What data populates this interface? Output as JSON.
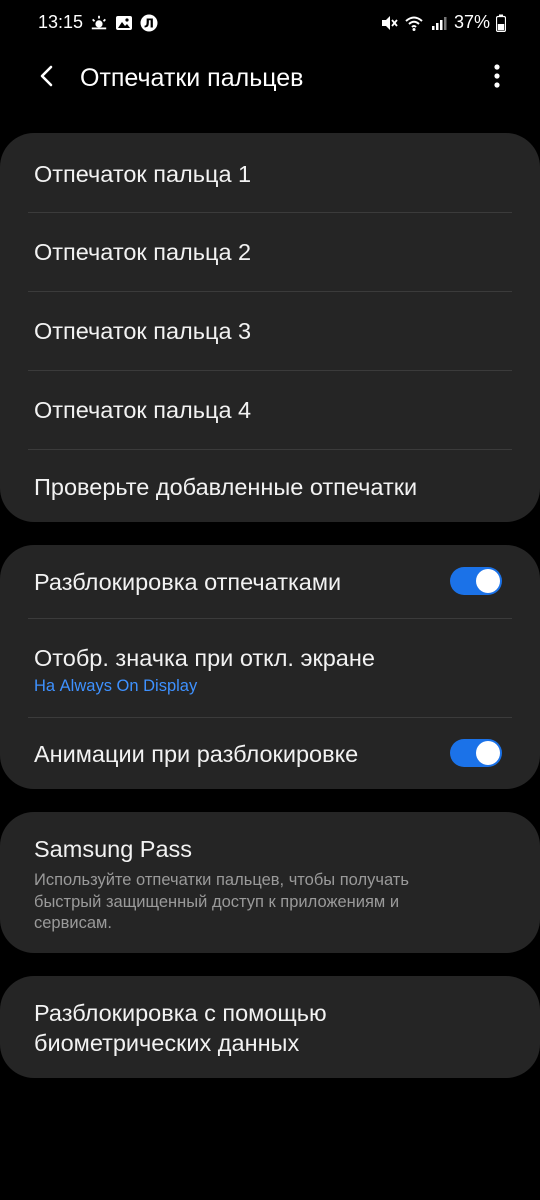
{
  "status_bar": {
    "time": "13:15",
    "battery": "37%",
    "left_icons": [
      "weather-icon",
      "gallery-icon",
      "app-notification-icon"
    ],
    "right_icons": [
      "mute-icon",
      "wifi-icon",
      "signal-icon",
      "battery-icon"
    ],
    "badge_letter": "Л"
  },
  "app_bar": {
    "title": "Отпечатки пальцев"
  },
  "fingerprints": {
    "items": [
      {
        "label": "Отпечаток пальца 1"
      },
      {
        "label": "Отпечаток пальца 2"
      },
      {
        "label": "Отпечаток пальца 3"
      },
      {
        "label": "Отпечаток пальца 4"
      }
    ],
    "check_label": "Проверьте добавленные отпечатки"
  },
  "settings": {
    "unlock": {
      "label": "Разблокировка отпечатками",
      "enabled": true
    },
    "screen_off_icon": {
      "label": "Отобр. значка при откл. экране",
      "value": "На Always On Display"
    },
    "animation": {
      "label": "Анимации при разблокировке",
      "enabled": true
    }
  },
  "samsung_pass": {
    "title": "Samsung Pass",
    "description": "Используйте отпечатки пальцев, чтобы получать быстрый защищенный доступ к приложениям и сервисам."
  },
  "biometrics": {
    "label": "Разблокировка с помощью биометрических данных"
  },
  "colors": {
    "background": "#000000",
    "card": "#252525",
    "accent": "#3e91ff",
    "toggle_on": "#1b72e8"
  }
}
